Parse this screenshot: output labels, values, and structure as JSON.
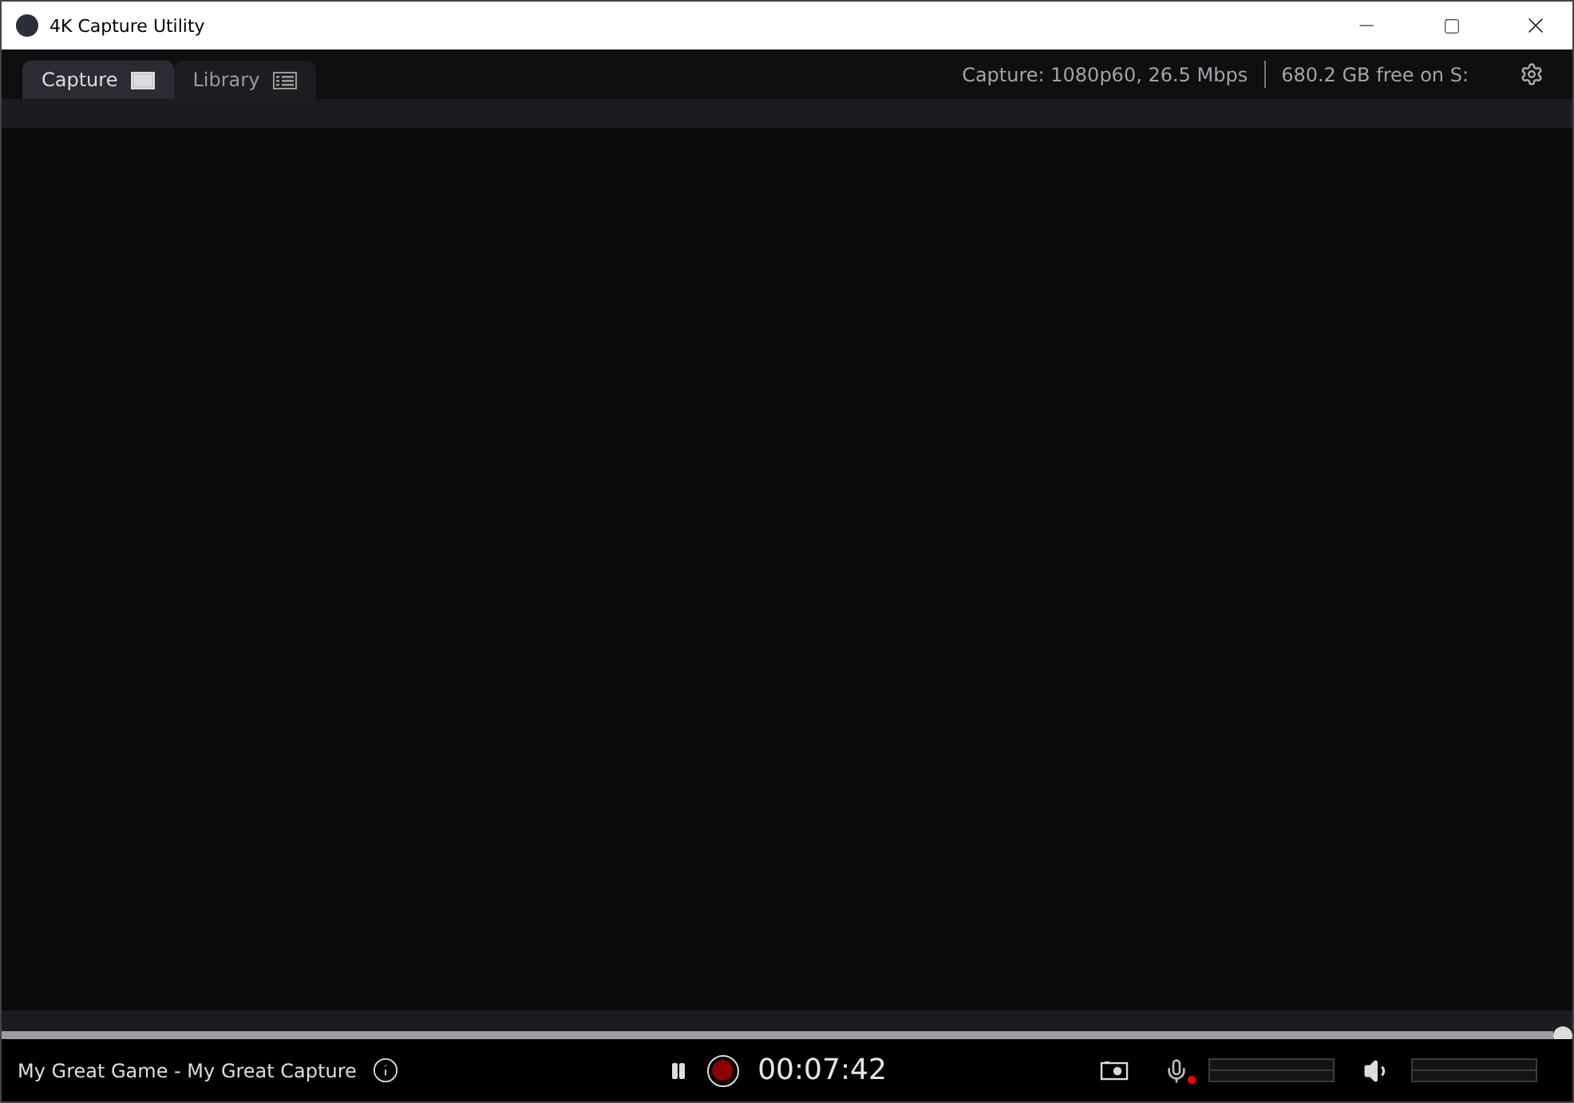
{
  "window": {
    "title": "4K Capture Utility"
  },
  "tabs": [
    {
      "label": "Capture",
      "kind": "capture",
      "selected": true
    },
    {
      "label": "Library",
      "kind": "library",
      "selected": false
    }
  ],
  "status": {
    "capture": "Capture: 1080p60, 26.5 Mbps",
    "storage": "680.2 GB free on S:"
  },
  "timeline": {
    "level": 1
  },
  "bottom_bar": {
    "title": "My Great Game - My Great Capture",
    "timer": "00:07:42",
    "recording": true,
    "microphone": {
      "muted": true,
      "level": 0
    },
    "speaker": {
      "level": 0
    }
  }
}
